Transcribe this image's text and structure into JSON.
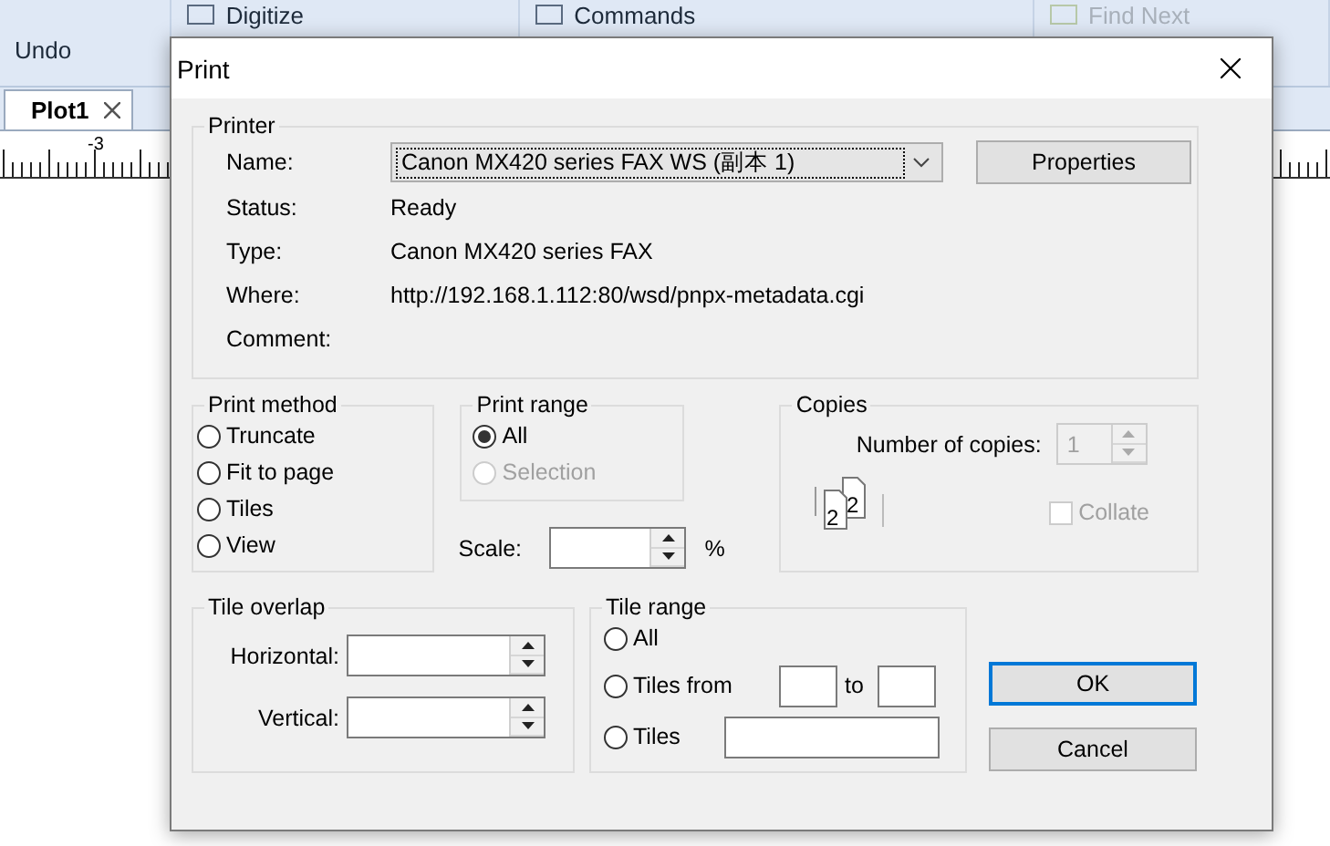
{
  "app": {
    "ribbon": [
      {
        "label": "Undo",
        "kind": "text",
        "disabled": false
      },
      {
        "label": "Digitize",
        "kind": "icon",
        "disabled": false
      },
      {
        "label": "Commands",
        "kind": "icon",
        "disabled": false
      },
      {
        "label": "Find Next",
        "kind": "icon",
        "disabled": true
      }
    ],
    "tabs": [
      {
        "label": "Plot1",
        "selected": true
      }
    ],
    "ruler_label": "-3"
  },
  "dialog": {
    "title": "Print",
    "printer": {
      "title": "Printer",
      "name_label": "Name:",
      "name_value": "Canon MX420 series FAX WS (副本 1)",
      "properties_button": "Properties",
      "fields": [
        {
          "label": "Status:",
          "value": "Ready"
        },
        {
          "label": "Type:",
          "value": "Canon MX420 series FAX"
        },
        {
          "label": "Where:",
          "value": "http://192.168.1.112:80/wsd/pnpx-metadata.cgi"
        },
        {
          "label": "Comment:"
        }
      ]
    },
    "print_method": {
      "title": "Print method",
      "options": [
        {
          "label": "Truncate",
          "selected": false
        },
        {
          "label": "Fit to page",
          "selected": false
        },
        {
          "label": "Tiles",
          "selected": false
        },
        {
          "label": "View",
          "selected": false
        }
      ]
    },
    "print_range": {
      "title": "Print range",
      "options": [
        {
          "label": "All",
          "selected": true,
          "disabled": false
        },
        {
          "label": "Selection",
          "selected": false,
          "disabled": true
        }
      ]
    },
    "scale": {
      "label": "Scale:",
      "unit": "%"
    },
    "copies": {
      "title": "Copies",
      "label": "Number of copies:",
      "value": "1",
      "disabled": true,
      "sheet_labels": [
        "2",
        "2"
      ],
      "collate": {
        "label": "Collate",
        "checked": false,
        "disabled": true
      }
    },
    "tile_overlap": {
      "title": "Tile overlap",
      "fields": [
        {
          "label": "Horizontal:"
        },
        {
          "label": "Vertical:"
        }
      ]
    },
    "tile_range": {
      "title": "Tile range",
      "options": [
        {
          "kind": "plain",
          "label": "All",
          "selected": false
        },
        {
          "kind": "range",
          "label": "Tiles from",
          "separator": "to",
          "selected": false
        },
        {
          "kind": "list",
          "label": "Tiles",
          "selected": false
        }
      ]
    },
    "buttons": [
      {
        "label": "OK",
        "default": true
      },
      {
        "label": "Cancel",
        "default": false
      }
    ]
  }
}
